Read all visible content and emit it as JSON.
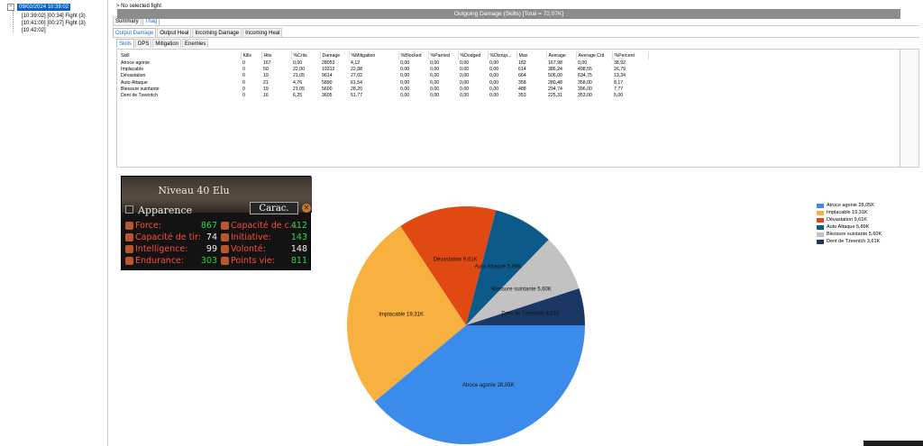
{
  "tree": {
    "root": "09/02/2024 10:39:02",
    "children": [
      "[10:39:02] [00:34] Fight (3)",
      "[10:41:00] [00:27] Fight (3)",
      "[10:42:02]"
    ]
  },
  "selection_info": "> No selected fight",
  "tabs_top": [
    "Summary",
    "Thag"
  ],
  "tabs_mid": [
    "Output Damage",
    "Output Heal",
    "Incoming Damage",
    "Incoming Heal"
  ],
  "tabs_sub": [
    "Skills",
    "DPS",
    "Mitigation",
    "Enemies"
  ],
  "table": {
    "headers": [
      "Skill",
      "Kills",
      "Hits",
      "%Crits",
      "Damage",
      "%Mitigation",
      "%Blocked",
      "%Parried",
      "%Dodged",
      "%Disrup...",
      "Max",
      "Average",
      "Average Crit",
      "%Percent"
    ],
    "rows": [
      [
        "Atroce agonie",
        "0",
        "167",
        "0,00",
        "28053",
        "4,12",
        "0,00",
        "0,00",
        "0,00",
        "0,00",
        "182",
        "167,98",
        "0,00",
        "38,92"
      ],
      [
        "Implacable",
        "0",
        "50",
        "22,00",
        "19312",
        "22,88",
        "0,00",
        "0,00",
        "0,00",
        "0,00",
        "614",
        "386,24",
        "498,55",
        "26,79"
      ],
      [
        "Dévastation",
        "0",
        "19",
        "21,05",
        "9614",
        "27,02",
        "0,00",
        "0,00",
        "0,00",
        "0,00",
        "664",
        "506,00",
        "634,75",
        "13,34"
      ],
      [
        "Auto Attaque",
        "0",
        "21",
        "4,76",
        "5890",
        "61,54",
        "0,00",
        "0,00",
        "0,00",
        "0,00",
        "358",
        "280,48",
        "358,00",
        "8,17"
      ],
      [
        "Blessure suintante",
        "0",
        "19",
        "21,05",
        "5600",
        "28,20",
        "0,00",
        "0,00",
        "0,00",
        "0,00",
        "488",
        "294,74",
        "396,00",
        "7,77"
      ],
      [
        "Dent de Tzeentch",
        "0",
        "16",
        "6,25",
        "3605",
        "51,77",
        "0,00",
        "0,00",
        "0,00",
        "0,00",
        "353",
        "225,31",
        "353,00",
        "5,00"
      ]
    ]
  },
  "chart_data": {
    "type": "pie",
    "title": "Outgoing Damage (Skills) [Total = 72,07K]",
    "categories": [
      "Atroce agonie",
      "Implacable",
      "Dévastation",
      "Auto Attaque",
      "Blessure suintante",
      "Dent de Tzeentch"
    ],
    "values": [
      28.05,
      19.31,
      9.61,
      5.89,
      5.6,
      3.61
    ],
    "slice_labels": [
      "Atroce agonie 28,05K",
      "Implacable 19,31K",
      "Dévastation 9,61K",
      "Auto Attaque 5,89K",
      "Blessure suintante 5,60K",
      "Dent de Tzeentch 3,61K"
    ],
    "legend_position": "right",
    "colors": [
      "#3b8beb",
      "#f8b13f",
      "#e04a12",
      "#0b5a8a",
      "#c2c2c2",
      "#1b3864"
    ]
  },
  "overlay": {
    "level": "Niveau 40 Elu",
    "appearance": "Apparence",
    "carac_button": "Carac.",
    "close_glyph": "✕",
    "stats": [
      {
        "label": "Force:",
        "value": "867",
        "color": "green"
      },
      {
        "label": "Capacité de c...",
        "value": "412",
        "color": "green"
      },
      {
        "label": "Capacité de tir:",
        "value": "74",
        "color": "white"
      },
      {
        "label": "Initiative:",
        "value": "143",
        "color": "green"
      },
      {
        "label": "Intelligence:",
        "value": "99",
        "color": "white"
      },
      {
        "label": "Volonté:",
        "value": "148",
        "color": "white"
      },
      {
        "label": "Endurance:",
        "value": "303",
        "color": "green"
      },
      {
        "label": "Points vie:",
        "value": "811",
        "color": "green"
      }
    ]
  }
}
